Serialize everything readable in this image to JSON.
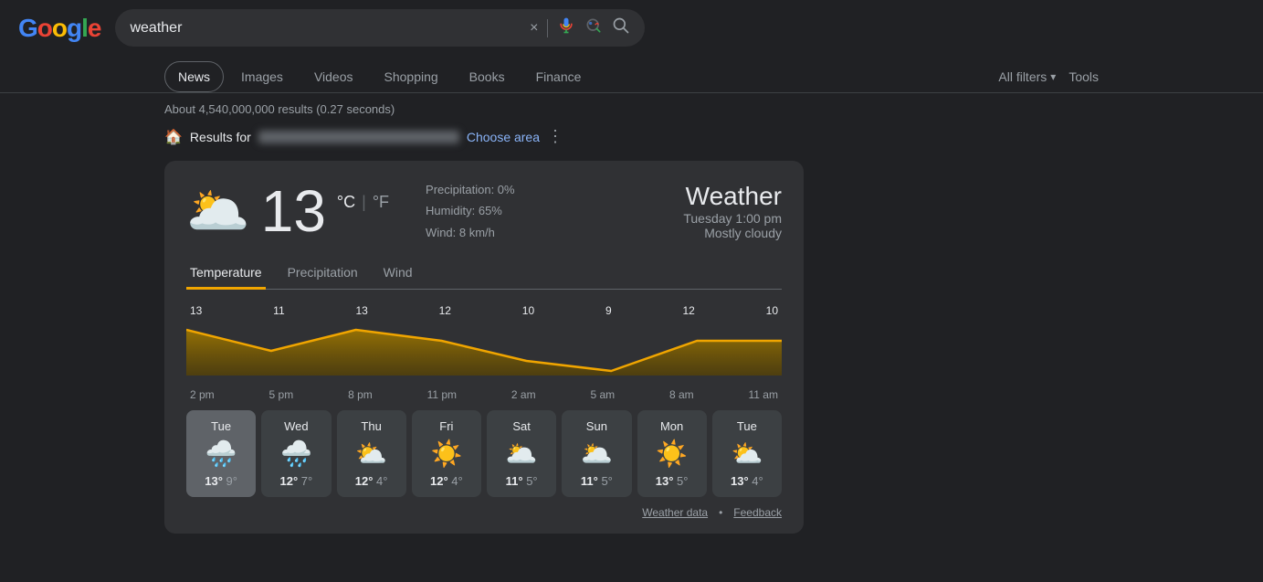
{
  "header": {
    "logo": "Google",
    "search_value": "weather",
    "clear_label": "×",
    "mic_label": "🎤",
    "lens_label": "🔍",
    "search_btn_label": "🔍"
  },
  "nav": {
    "tabs": [
      {
        "label": "News",
        "active": false
      },
      {
        "label": "Images",
        "active": false
      },
      {
        "label": "Videos",
        "active": false
      },
      {
        "label": "Shopping",
        "active": false
      },
      {
        "label": "Books",
        "active": false
      },
      {
        "label": "Finance",
        "active": false
      }
    ],
    "all_filters": "All filters",
    "tools": "Tools"
  },
  "results": {
    "count": "About 4,540,000,000 results (0.27 seconds)"
  },
  "location": {
    "results_for": "Results for",
    "choose_area": "Choose area"
  },
  "weather": {
    "title": "Weather",
    "date": "Tuesday 1:00 pm",
    "condition": "Mostly cloudy",
    "temperature": "13",
    "unit_c": "°C",
    "unit_sep": "|",
    "unit_f": "°F",
    "precipitation": "Precipitation: 0%",
    "humidity": "Humidity: 65%",
    "wind": "Wind: 8 km/h",
    "tabs": [
      {
        "label": "Temperature",
        "active": true
      },
      {
        "label": "Precipitation",
        "active": false
      },
      {
        "label": "Wind",
        "active": false
      }
    ],
    "chart": {
      "values": [
        13,
        11,
        13,
        12,
        10,
        9,
        12,
        10
      ],
      "times": [
        "2 pm",
        "5 pm",
        "8 pm",
        "11 pm",
        "2 am",
        "5 am",
        "8 am",
        "11 am"
      ]
    },
    "days": [
      {
        "name": "Tue",
        "icon": "🌧️",
        "high": "13°",
        "low": "9°",
        "active": true
      },
      {
        "name": "Wed",
        "icon": "🌧️",
        "high": "12°",
        "low": "7°",
        "active": false
      },
      {
        "name": "Thu",
        "icon": "⛅",
        "high": "12°",
        "low": "4°",
        "active": false
      },
      {
        "name": "Fri",
        "icon": "☀️",
        "high": "12°",
        "low": "4°",
        "active": false
      },
      {
        "name": "Sat",
        "icon": "🌥️",
        "high": "11°",
        "low": "5°",
        "active": false
      },
      {
        "name": "Sun",
        "icon": "🌥️",
        "high": "11°",
        "low": "5°",
        "active": false
      },
      {
        "name": "Mon",
        "icon": "☀️",
        "high": "13°",
        "low": "5°",
        "active": false
      },
      {
        "name": "Tue",
        "icon": "⛅",
        "high": "13°",
        "low": "4°",
        "active": false
      }
    ],
    "footer_data": "Weather data",
    "footer_feedback": "Feedback"
  }
}
